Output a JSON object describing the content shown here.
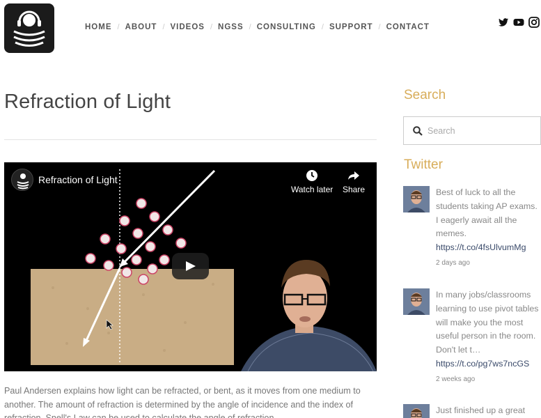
{
  "header": {
    "nav": [
      "HOME",
      "ABOUT",
      "VIDEOS",
      "NGSS",
      "CONSULTING",
      "SUPPORT",
      "CONTACT"
    ],
    "social_icons": [
      "twitter-icon",
      "youtube-icon",
      "instagram-icon"
    ]
  },
  "main": {
    "title": "Refraction of Light",
    "video": {
      "title": "Refraction of Light",
      "watch_later": "Watch later",
      "share": "Share"
    },
    "description": "Paul Andersen explains how light can be refracted, or bent, as it moves from one medium to another. The amount of refraction is determined by the angle of incidence and the index of refraction. Snell's Law can be used to calculate the angle of refraction."
  },
  "sidebar": {
    "search_heading": "Search",
    "search_placeholder": "Search",
    "twitter_heading": "Twitter",
    "tweets": [
      {
        "text": "Best of luck to all the students taking AP exams. I eagerly await all the memes.",
        "link": "https://t.co/4fsUlvumMg",
        "time": "2 days ago"
      },
      {
        "text": "In many jobs/classrooms learning to use pivot tables will make you the most useful person in the room. Don't let t…",
        "link": "https://t.co/pg7ws7ncGS",
        "time": "2 weeks ago"
      },
      {
        "text": "Just finished up a great",
        "link": "",
        "time": ""
      }
    ]
  },
  "colors": {
    "accent": "#d8ad5a",
    "link": "#3a4a6a",
    "text": "#555555"
  }
}
